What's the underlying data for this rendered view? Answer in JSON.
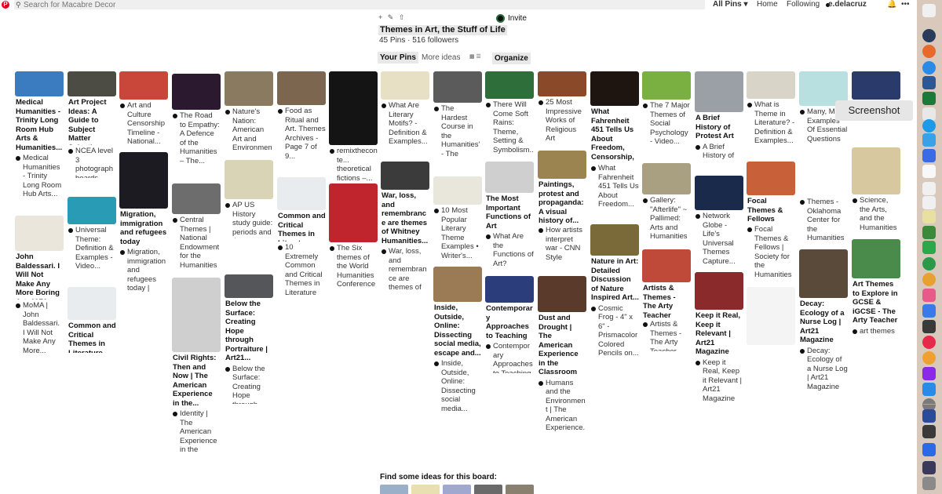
{
  "topbar": {
    "search_placeholder": "Search for Macabre Decor",
    "logo": "P",
    "all_pins": "All Pins ▾",
    "home": "Home",
    "following": "Following",
    "user": "e.delacruz",
    "bell": "🔔",
    "more": "•••"
  },
  "board": {
    "tools": [
      "+",
      "✎",
      "⇧"
    ],
    "invite": "Invite",
    "title": "Themes in Art, the Stuff of Life",
    "stats": "45 Pins · 516 followers",
    "tab_pins": "Your Pins",
    "tab_ideas": "More ideas",
    "view_toggle": "▦ ☰",
    "organize": "Organize"
  },
  "tooltip": "Screenshot",
  "find_ideas": "Find some ideas for this board:",
  "colors": {
    "accent": "#e60023",
    "dock": "#d9c9bd",
    "chip": "#e8e8e8"
  },
  "pins": [
    {
      "title": "Medical Humanities - Trinity Long Room Hub Arts & Humanities...",
      "desc": "Medical Humanities - Trinity Long Room Hub Arts...",
      "bg": "#3a7cbf"
    },
    {
      "title": "John Baldessari. I Will Not Make Any More Boring Art. 1971",
      "desc": "MoMA | John Baldessari. I Will Not Make Any More...",
      "bg": "#eae6dc"
    },
    {
      "title": "Art Project Ideas: A Guide to Subject Matter Selection",
      "desc": "NCEA level 3 photograph boards",
      "bg": "#4c4c44"
    },
    {
      "title": "",
      "desc": "Universal Theme: Definition & Examples - Video...",
      "bg": "#2a9bb5"
    },
    {
      "title": "Common and Critical Themes in Literature",
      "desc": "",
      "bg": "#e9ecef"
    },
    {
      "title": "",
      "desc": "Art and Culture Censorship Timeline - National...",
      "bg": "#c8473a"
    },
    {
      "title": "Migration, immigration and refugees today",
      "desc": "Migration, immigration and refugees today | Cornell...",
      "bg": "#1d1b22"
    },
    {
      "title": "",
      "desc": "The Road to Empathy: A Defence of the Humanities – The...",
      "bg": "#2b1a2f"
    },
    {
      "title": "",
      "desc": "Central Themes | National Endowment for the Humanities",
      "bg": "#6d6d6d"
    },
    {
      "title": "Civil Rights: Then and Now | The American Experience in the...",
      "desc": "Identity | The American Experience in the Classroom",
      "bg": "#cfcfcf"
    },
    {
      "title": "",
      "desc": "Nature's Nation: American Art and Environment...",
      "bg": "#8a7a60"
    },
    {
      "title": "",
      "desc": "AP US History study guide: periods and themes...",
      "bg": "#d9d4b6"
    },
    {
      "title": "Below the Surface: Creating Hope through Portraiture | Art21...",
      "desc": "Below the Surface: Creating Hope through Portraiture.",
      "bg": "#55565a"
    },
    {
      "title": "",
      "desc": "Food as Ritual and Art. Themes Archives - Page 7 of 9...",
      "bg": "#7d6650"
    },
    {
      "title": "Common and Critical Themes in Literature",
      "desc": "10 Extremely Common and Critical Themes in Literature",
      "bg": "#e9ecef"
    },
    {
      "title": "",
      "desc": "remixtheconte... theoretical fictions –...",
      "bg": "#141414"
    },
    {
      "title": "",
      "desc": "The Six themes of the World Humanities Conference",
      "bg": "#c0242d"
    },
    {
      "title": "",
      "desc": "What Are Literary Motifs? - Definition & Examples...",
      "bg": "#e8e0c4"
    },
    {
      "title": "War, loss, and remembrance are themes of Whitney Humanities...",
      "desc": "War, loss, and remembrance are themes of Whitney...",
      "bg": "#3b3b3b"
    },
    {
      "title": "",
      "desc": "The Hardest Course in the Humanities' - The Chronicle...",
      "bg": "#5b5b5b"
    },
    {
      "title": "",
      "desc": "10 Most Popular Literary Theme Examples • Writer's...",
      "bg": "#e9e6dc"
    },
    {
      "title": "Inside, Outside, Online: Dissecting social media, escape and...",
      "desc": "Inside, Outside, Online: Dissecting social media...",
      "bg": "#9a7b56"
    },
    {
      "title": "",
      "desc": "There Will Come Soft Rains: Theme, Setting & Symbolism...",
      "bg": "#2e6e3a"
    },
    {
      "title": "The Most Important Functions of Art",
      "desc": "What Are the Functions of Art?",
      "bg": "#cfcfcf"
    },
    {
      "title": "Contemporary Approaches to Teaching — Art21",
      "desc": "Contemporary Approaches to Teaching | Art21",
      "bg": "#2b3d7a"
    },
    {
      "title": "",
      "desc": "25 Most Impressive Works of Religious Art",
      "bg": "#8a4a2a"
    },
    {
      "title": "Paintings, protest and propaganda: A visual history of...",
      "desc": "How artists interpret war - CNN Style",
      "bg": "#9b8450"
    },
    {
      "title": "Dust and Drought | The American Experience in the Classroom",
      "desc": "Humans and the Environment | The American Experience...",
      "bg": "#5a3a2a"
    },
    {
      "title": "What Fahrenheit 451 Tells Us About Freedom, Censorship, and...",
      "desc": "What Fahrenheit 451 Tells Us About Freedom...",
      "bg": "#1e1410"
    },
    {
      "title": "Nature in Art: Detailed Discussion of Nature Inspired Art...",
      "desc": "Cosmic Frog - 4\" x 6\" - Prismacolor Colored Pencils on...",
      "bg": "#7a6a3a"
    },
    {
      "title": "",
      "desc": "The 7 Major Themes of Social Psychology - Video...",
      "bg": "#7ab041"
    },
    {
      "title": "",
      "desc": "Gallery: \"Afterlife\" ~ Pallimed: Arts and Humanities",
      "bg": "#a8a080"
    },
    {
      "title": "Artists & Themes - The Arty Teacher",
      "desc": "Artists & Themes - The Arty Teacher",
      "bg": "#c04a3a"
    },
    {
      "title": "A Brief History of Protest Art",
      "desc": "A Brief History of Protest Art",
      "bg": "#9aa0a6"
    },
    {
      "title": "",
      "desc": "Network Globe - Life's Universal Themes Capture...",
      "bg": "#1a2a4a"
    },
    {
      "title": "Keep it Real, Keep it Relevant | Art21 Magazine",
      "desc": "Keep it Real, Keep it Relevant | Art21 Magazine",
      "bg": "#8a2a2a"
    },
    {
      "title": "",
      "desc": "What is Theme in Literature? - Definition & Examples...",
      "bg": "#d8d4c8"
    },
    {
      "title": "Focal Themes & Fellows",
      "desc": "Focal Themes & Fellows | Society for the Humanities",
      "bg": "#c8603a"
    },
    {
      "title": "",
      "desc": "",
      "bg": "#f4f4f4"
    },
    {
      "title": "",
      "desc": "Many, Many Examples Of Essential Questions",
      "bg": "#b8e0e0"
    },
    {
      "title": "",
      "desc": "Themes - Oklahoma Center for the Humanities",
      "bg": "#ffffff"
    },
    {
      "title": "Decay: Ecology of a Nurse Log | Art21 Magazine",
      "desc": "Decay: Ecology of a Nurse Log | Art21 Magazine",
      "bg": "#5a4a3a"
    },
    {
      "title": "Magazine on Twitter",
      "desc": "",
      "bg": "#2a3a6a"
    },
    {
      "title": "",
      "desc": "Science, the Arts, and the Humanities",
      "bg": "#d8c8a0"
    },
    {
      "title": "Art Themes to Explore in GCSE & iGCSE - The Arty Teacher",
      "desc": "art themes",
      "bg": "#4a8a4a"
    }
  ]
}
